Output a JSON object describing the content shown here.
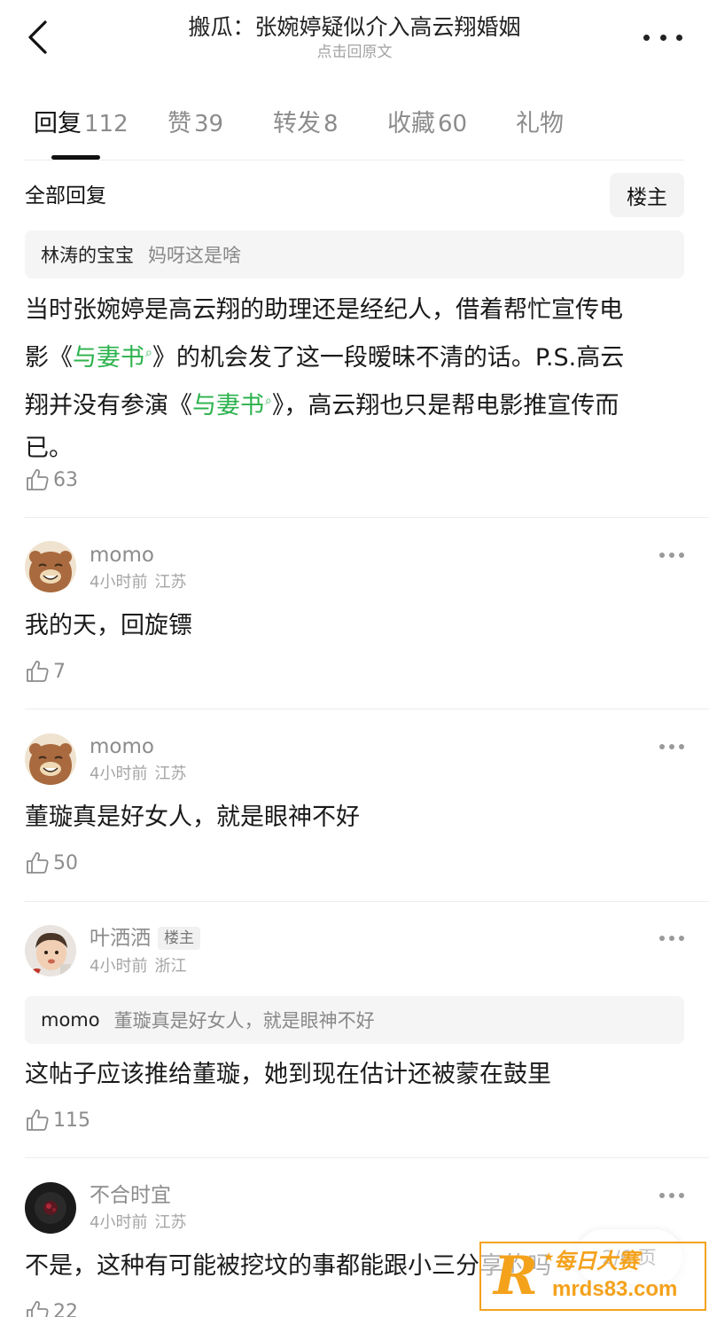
{
  "header": {
    "title": "搬瓜：张婉婷疑似介入高云翔婚姻",
    "subtitle": "点击回原文"
  },
  "tabs": [
    {
      "label": "回复",
      "count": "112"
    },
    {
      "label": "赞",
      "count": "39"
    },
    {
      "label": "转发",
      "count": "8"
    },
    {
      "label": "收藏",
      "count": "60"
    },
    {
      "label": "礼物",
      "count": ""
    }
  ],
  "filter": {
    "all_label": "全部回复",
    "op_only_label": "楼主"
  },
  "focused_reply": {
    "quote_user": "林涛的宝宝",
    "quote_text": "妈呀这是啥",
    "text_lines": [
      [
        "当时张婉婷是高云翔的助理还是经纪人，借着帮忙宣传电"
      ],
      [
        "影《",
        {
          "link": "与妻书"
        },
        "》的机会发了这一段暧昧不清的话。P.S.高云"
      ],
      [
        "翔并没有参演《",
        {
          "link": "与妻书"
        },
        "》，高云翔也只是帮电影推宣传而"
      ],
      [
        "已。"
      ]
    ],
    "likes": "63"
  },
  "comments": [
    {
      "username": "momo",
      "time": "4小时前",
      "location": "江苏",
      "text": "我的天，回旋镖",
      "likes": "7",
      "avatar": "bear"
    },
    {
      "username": "momo",
      "time": "4小时前",
      "location": "江苏",
      "text": "董璇真是好女人，就是眼神不好",
      "likes": "50",
      "avatar": "bear"
    },
    {
      "username": "叶洒洒",
      "badge": "楼主",
      "time": "4小时前",
      "location": "浙江",
      "quote_user": "momo",
      "quote_text": "董璇真是好女人，就是眼神不好",
      "text": "这帖子应该推给董璇，她到现在估计还被蒙在鼓里",
      "likes": "115",
      "avatar": "child"
    },
    {
      "username": "不合时宜",
      "time": "4小时前",
      "location": "江苏",
      "text": "不是，这种有可能被挖坟的事都能跟小三分享的吗",
      "likes": "22",
      "avatar": "dark"
    }
  ],
  "pager": {
    "label": "2/6 页"
  },
  "watermark": {
    "cn": "每日大赛",
    "url": "mrds83.com"
  },
  "colors": {
    "link": "#2bb24c",
    "muted": "#8c8c8c",
    "watermark": "#f4a21c"
  },
  "icons": [
    "back-arrow-icon",
    "more-dots-icon",
    "thumbs-up-icon",
    "search-icon"
  ]
}
